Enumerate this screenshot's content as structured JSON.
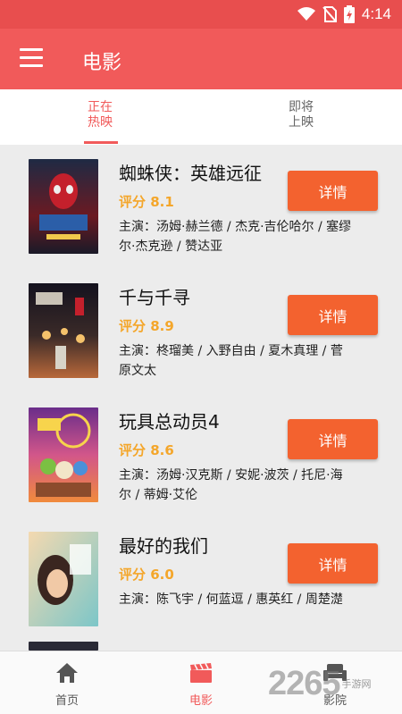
{
  "status_bar": {
    "time": "4:14"
  },
  "app_bar": {
    "title": "电影"
  },
  "tabs": [
    {
      "line1": "正在",
      "line2": "热映"
    },
    {
      "line1": "即将",
      "line2": "上映"
    }
  ],
  "movies": [
    {
      "title": "蜘蛛侠：英雄远征",
      "score": "评分 8.1",
      "cast_line1": "主演：汤姆·赫兰德 / 杰克·吉伦哈尔 / 塞缪",
      "cast_line2": "尔·杰克逊 / 赞达亚",
      "button": "详情"
    },
    {
      "title": "千与千寻",
      "score": "评分 8.9",
      "cast_line1": "主演：柊瑠美 / 入野自由 / 夏木真理 / 菅",
      "cast_line2": "原文太",
      "button": "详情"
    },
    {
      "title": "玩具总动员4",
      "score": "评分 8.6",
      "cast_line1": "主演：汤姆·汉克斯 / 安妮·波茨 / 托尼·海",
      "cast_line2": "尔 / 蒂姆·艾伦",
      "button": "详情"
    },
    {
      "title": "最好的我们",
      "score": "评分 6.0",
      "cast_line1": "主演：陈飞宇 / 何蓝逗 / 惠英红 / 周楚濋",
      "cast_line2": "",
      "button": "详情"
    }
  ],
  "bottom_nav": [
    {
      "label": "首页",
      "icon": "home-icon"
    },
    {
      "label": "电影",
      "icon": "clapperboard-icon"
    },
    {
      "label": "影院",
      "icon": "cinema-seat-icon"
    }
  ],
  "watermark": {
    "number": "2265",
    "tag": "手游网"
  },
  "colors": {
    "primary": "#f15a5a",
    "button": "#f3622f",
    "score": "#f4a62a"
  }
}
